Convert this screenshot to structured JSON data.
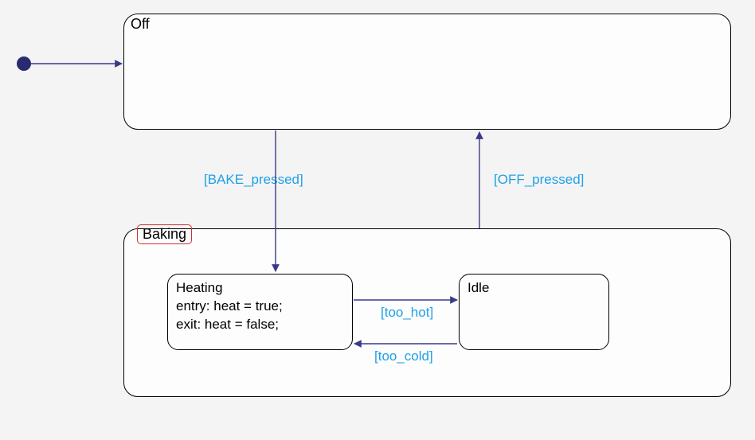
{
  "diagram": {
    "type": "state-machine",
    "states": {
      "off": {
        "name": "Off"
      },
      "baking": {
        "name": "Baking",
        "substates": {
          "heating": {
            "name": "Heating",
            "entry": "entry: heat = true;",
            "exit": "exit: heat = false;"
          },
          "idle": {
            "name": "Idle"
          }
        }
      }
    },
    "transitions": {
      "bake_pressed": "[BAKE_pressed]",
      "off_pressed": "[OFF_pressed]",
      "too_hot": "[too_hot]",
      "too_cold": "[too_cold]"
    }
  }
}
